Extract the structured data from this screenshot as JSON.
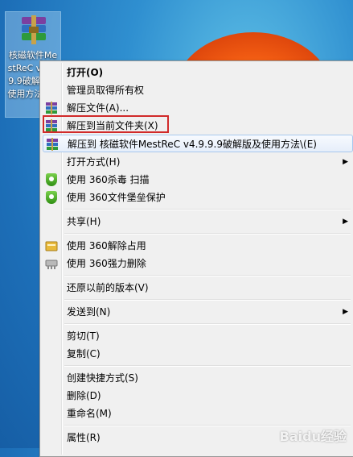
{
  "desktop": {
    "icon_label": "核磁软件MestReC v4.9.9.9破解版及使用方法.rar",
    "watermark": "Baidu经验"
  },
  "menu": {
    "items": [
      {
        "label": "打开(O)",
        "bold": true
      },
      {
        "label": "管理员取得所有权"
      },
      {
        "label": "解压文件(A)...",
        "icon": "winrar-icon"
      },
      {
        "label": "解压到当前文件夹(X)",
        "icon": "winrar-icon"
      },
      {
        "label": "解压到 核磁软件MestReC v4.9.9.9破解版及使用方法\\(E)",
        "icon": "winrar-icon"
      },
      {
        "label": "打开方式(H)",
        "submenu": true
      },
      {
        "label": "使用 360杀毒 扫描",
        "icon": "360-shield-icon"
      },
      {
        "label": "使用 360文件堡垒保护",
        "icon": "360-shield-icon"
      },
      {
        "label": "共享(H)",
        "submenu": true
      },
      {
        "label": "使用 360解除占用",
        "icon": "360-unlock-icon"
      },
      {
        "label": "使用 360强力删除",
        "icon": "360-shredder-icon"
      },
      {
        "label": "还原以前的版本(V)"
      },
      {
        "label": "发送到(N)",
        "submenu": true
      },
      {
        "label": "剪切(T)"
      },
      {
        "label": "复制(C)"
      },
      {
        "label": "创建快捷方式(S)"
      },
      {
        "label": "删除(D)"
      },
      {
        "label": "重命名(M)"
      },
      {
        "label": "属性(R)"
      }
    ],
    "submenu_arrow": "▶"
  }
}
